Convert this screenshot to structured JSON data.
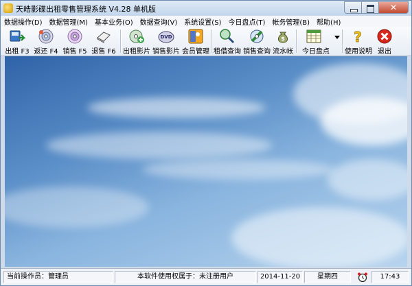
{
  "window": {
    "title": "天皓影碟出租零售管理系统 V4.28 单机版"
  },
  "menu": [
    "数据操作(D)",
    "数据管理(M)",
    "基本业务(O)",
    "数据查询(V)",
    "系统设置(S)",
    "今日盘点(T)",
    "帐务管理(B)",
    "帮助(H)"
  ],
  "toolbar": {
    "rent": "出租 F3",
    "return": "返还 F4",
    "sell": "销售 F5",
    "sell_return": "退售 F6",
    "rent_movies": "出租影片",
    "sell_movies": "销售影片",
    "members": "会员管理",
    "rent_query": "租借查询",
    "sell_query": "销售查询",
    "ledger": "流水帐",
    "daily_check": "今日盘点",
    "help": "使用说明",
    "exit": "退出"
  },
  "status": {
    "operator_label": "当前操作员：",
    "operator": "管理员",
    "license": "本软件使用权属于：未注册用户",
    "date": "2014-11-20",
    "weekday": "星期四",
    "time": "17:43"
  },
  "icons": {
    "app": "app-icon",
    "clock": "alarm-clock-icon"
  }
}
